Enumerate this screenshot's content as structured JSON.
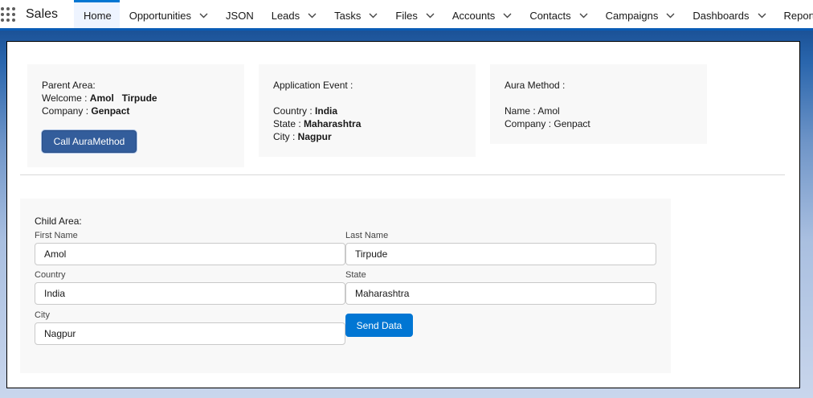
{
  "nav": {
    "app_name": "Sales",
    "items": [
      {
        "label": "Home",
        "active": true,
        "dropdown": false
      },
      {
        "label": "Opportunities",
        "dropdown": true
      },
      {
        "label": "JSON",
        "dropdown": false
      },
      {
        "label": "Leads",
        "dropdown": true
      },
      {
        "label": "Tasks",
        "dropdown": true
      },
      {
        "label": "Files",
        "dropdown": true
      },
      {
        "label": "Accounts",
        "dropdown": true
      },
      {
        "label": "Contacts",
        "dropdown": true
      },
      {
        "label": "Campaigns",
        "dropdown": true
      },
      {
        "label": "Dashboards",
        "dropdown": true
      },
      {
        "label": "Reports",
        "dropdown": true
      }
    ]
  },
  "parent": {
    "heading": "Parent Area:",
    "welcome_label": "Welcome : ",
    "welcome_value": "Amol   Tirpude",
    "company_label": "Company : ",
    "company_value": "Genpact",
    "button_label": "Call AuraMethod"
  },
  "app_event": {
    "heading": "Application Event :",
    "country_label": "Country : ",
    "country_value": "India",
    "state_label": "State : ",
    "state_value": "Maharashtra",
    "city_label": "City : ",
    "city_value": "Nagpur"
  },
  "aura": {
    "heading": "Aura Method :",
    "name_line": "Name : Amol",
    "company_line": "Company : Genpact"
  },
  "child": {
    "heading": "Child Area:",
    "first_name_label": "First Name",
    "first_name_value": "Amol",
    "last_name_label": "Last Name",
    "last_name_value": "Tirpude",
    "country_label": "Country",
    "country_value": "India",
    "state_label": "State",
    "state_value": "Maharashtra",
    "city_label": "City",
    "city_value": "Nagpur",
    "send_button_label": "Send Data"
  },
  "colors": {
    "brand_blue": "#0176d3",
    "backdrop_blue": "#1b5297",
    "dark_button": "#335d9b"
  },
  "icons": {
    "app_launcher": "waffle-icon",
    "dropdown": "chevron-down-icon"
  }
}
